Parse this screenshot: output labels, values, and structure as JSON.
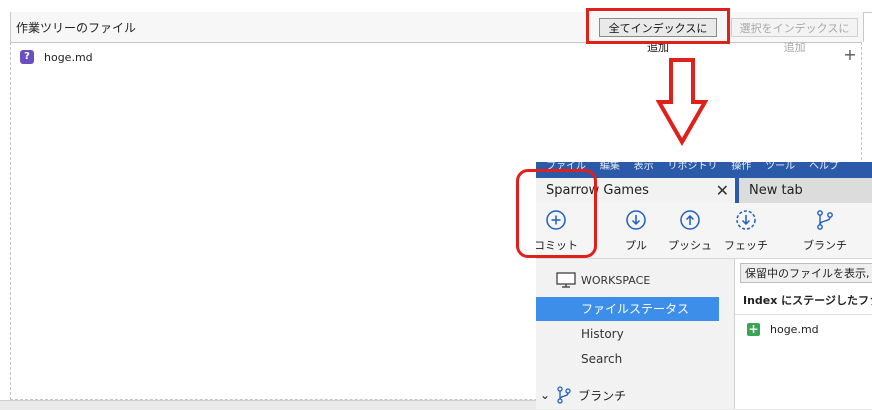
{
  "working_tree": {
    "title": "作業ツリーのファイル",
    "add_all_label": "全てインデックスに追加",
    "add_selected_label": "選択をインデックスに追加",
    "files": [
      {
        "name": "hoge.md",
        "status_glyph": "?"
      }
    ]
  },
  "app": {
    "menu_items": [
      "ファイル",
      "編集",
      "表示",
      "リポジトリ",
      "操作",
      "ツール",
      "ヘルプ"
    ],
    "tabs": [
      {
        "label": "Sparrow Games",
        "active": true
      },
      {
        "label": "New tab",
        "active": false
      }
    ],
    "toolbar": [
      {
        "label": "コミット",
        "icon": "plus-circle-icon"
      },
      {
        "label": "プル",
        "icon": "arrow-down-circle-icon"
      },
      {
        "label": "プッシュ",
        "icon": "arrow-up-circle-icon"
      },
      {
        "label": "フェッチ",
        "icon": "fetch-icon"
      },
      {
        "label": "ブランチ",
        "icon": "branch-icon"
      }
    ],
    "sidebar": {
      "workspace_label": "WORKSPACE",
      "items": [
        {
          "label": "ファイルステータス",
          "active": true
        },
        {
          "label": "History",
          "active": false
        },
        {
          "label": "Search",
          "active": false
        }
      ],
      "branch_label": "ブランチ"
    },
    "right_pane": {
      "stash_button": "保留中のファイルを表示, フ",
      "index_header": "Index にステージしたファイル",
      "staged_files": [
        {
          "name": "hoge.md",
          "status_glyph": "+"
        }
      ]
    }
  },
  "colors": {
    "highlight_red": "#e0201b",
    "accent_blue": "#3d8ee8",
    "titlebar_blue": "#2a5aa8",
    "unknown_badge": "#6a4fbf",
    "added_badge": "#3aa655"
  }
}
